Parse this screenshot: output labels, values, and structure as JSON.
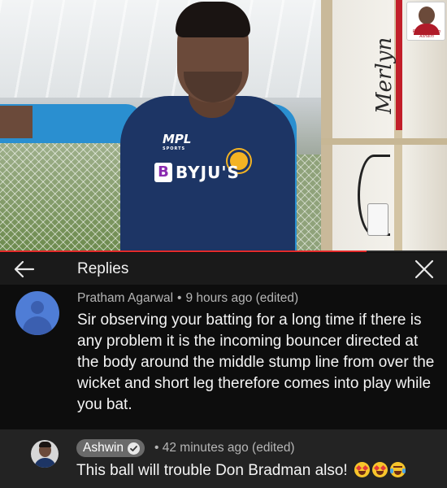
{
  "video": {
    "jersey_sponsor": "BYJU'S",
    "jersey_logo": "MPL",
    "jersey_logo_sub": "SPORTS",
    "machine_brand": "Merlyn",
    "channel_badge_caption": "Ravichandran Ashwin",
    "progress_fraction": 0.82,
    "progress_color": "#e12a2a"
  },
  "header": {
    "title": "Replies",
    "back_icon": "arrow-left-icon",
    "close_icon": "close-icon"
  },
  "parent_comment": {
    "author": "Pratham Agarwal",
    "separator": "•",
    "time": "9 hours ago (edited)",
    "text": "Sir observing your batting for a long time if there is any problem it is the incoming bouncer directed at the body around the middle stump line from over the wicket and short leg therefore comes into play while you bat.",
    "avatar_color": "#4f7dd6"
  },
  "reply": {
    "author": "Ashwin",
    "verified_icon": "verified-check-icon",
    "separator": "•",
    "time": "42 minutes ago (edited)",
    "text": "This ball will trouble Don Bradman also!",
    "emojis": [
      "star-struck-emoji",
      "star-struck-emoji",
      "laughing-tears-emoji"
    ]
  },
  "colors": {
    "background": "#0f0f0f",
    "header_bg": "#1a1a1a",
    "reply_bg": "#232323",
    "meta_text": "#b5b5b5",
    "author_chip": "#6a6a6a"
  }
}
